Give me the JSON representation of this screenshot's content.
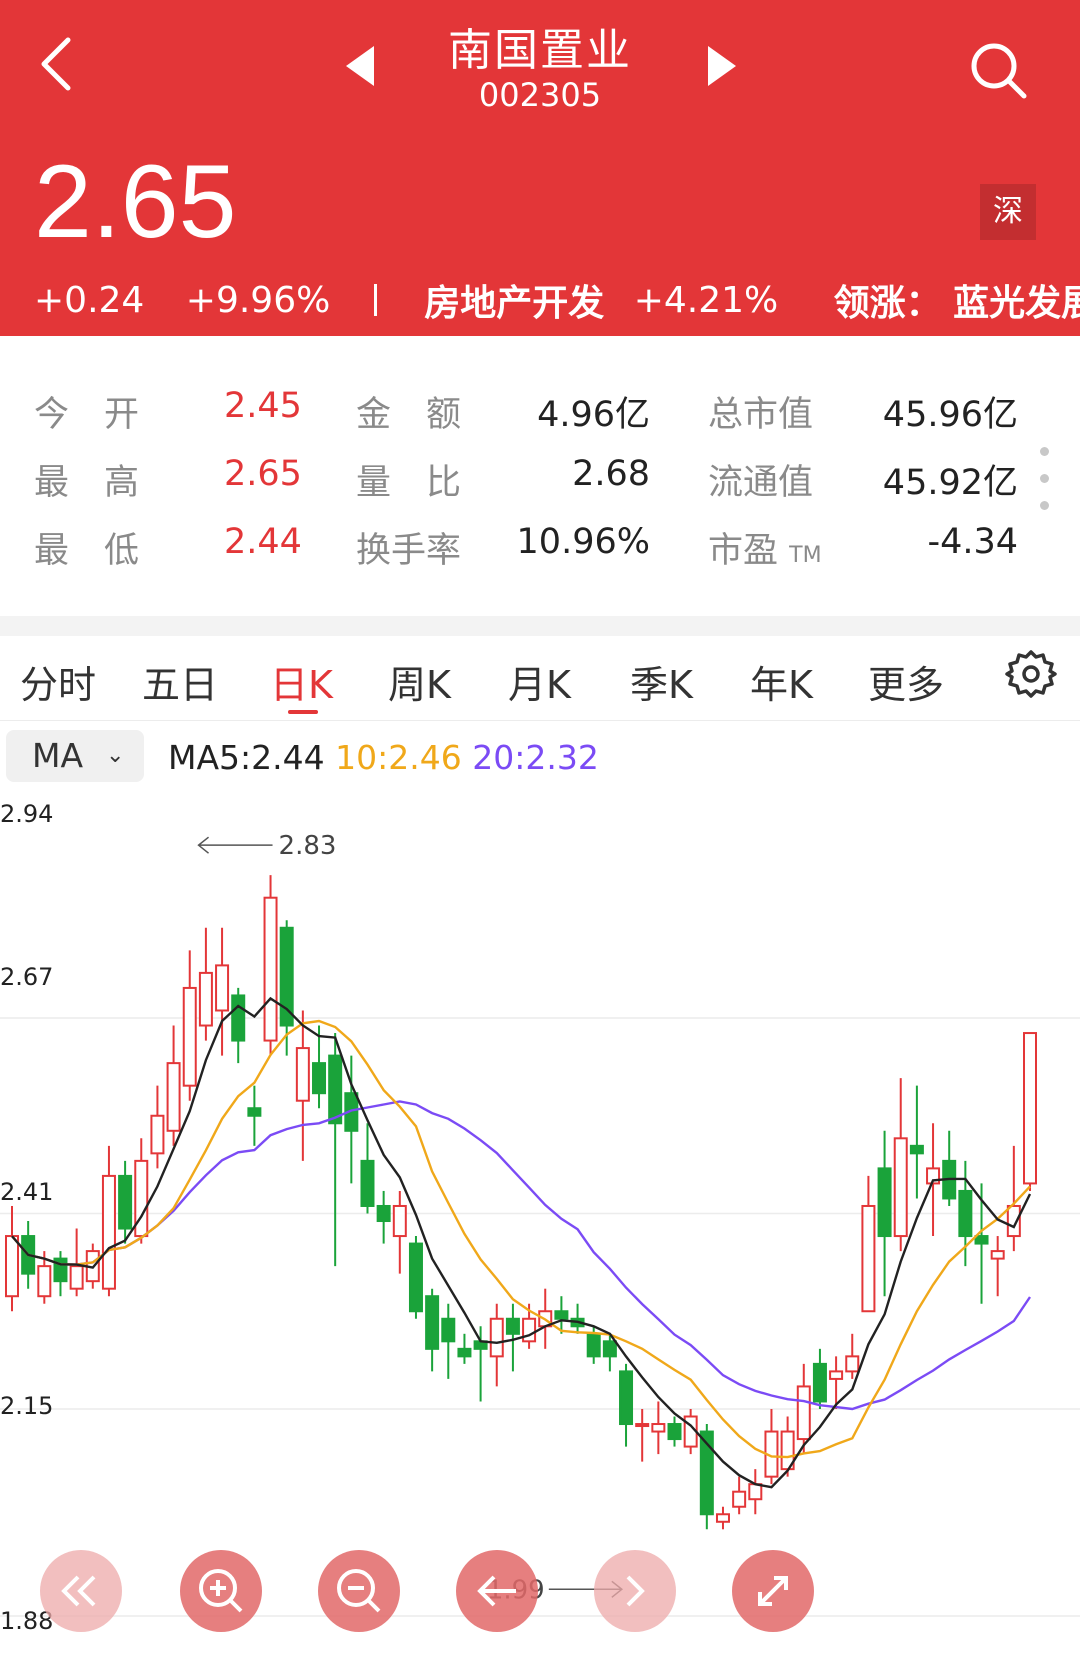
{
  "header": {
    "stock_name": "南国置业",
    "stock_code": "002305",
    "price": "2.65",
    "exchange": "深",
    "change": "+0.24",
    "change_pct": "+9.96%",
    "sector_name": "房地产开发",
    "sector_pct": "+4.21%",
    "leader_label": "领涨：",
    "leader_name": "蓝光发展",
    "bg_color": "#e33638"
  },
  "stats": {
    "open_label": "今　开",
    "open": "2.45",
    "high_label": "最　高",
    "high": "2.65",
    "low_label": "最　低",
    "low": "2.44",
    "amount_label": "金　额",
    "amount": "4.96亿",
    "vol_ratio_label": "量　比",
    "vol_ratio": "2.68",
    "turnover_label": "换手率",
    "turnover": "10.96%",
    "mkt_cap_label": "总市值",
    "mkt_cap": "45.96亿",
    "float_cap_label": "流通值",
    "float_cap": "45.92亿",
    "pe_label": "市盈",
    "pe_suffix": "TM",
    "pe": "-4.34"
  },
  "tabs": [
    "分时",
    "五日",
    "日K",
    "周K",
    "月K",
    "季K",
    "年K",
    "更多"
  ],
  "active_tab": "日K",
  "ma": {
    "selector": "MA",
    "ma5": "MA5:2.44",
    "ma10": "10:2.46",
    "ma20": "20:2.32",
    "colors": {
      "ma5": "#222222",
      "ma10": "#f0a81a",
      "ma20": "#7b4bf5"
    }
  },
  "chart_data": {
    "type": "candlestick",
    "y_ticks": [
      "2.94",
      "2.67",
      "2.41",
      "2.15",
      "1.88"
    ],
    "ylim": [
      1.88,
      2.94
    ],
    "max_marker": "2.83",
    "min_marker": "1.99",
    "up_color": "#e33638",
    "down_color": "#1aa33a",
    "candles": [
      [
        2.3,
        2.38,
        2.42,
        2.28
      ],
      [
        2.38,
        2.33,
        2.4,
        2.31
      ],
      [
        2.3,
        2.34,
        2.36,
        2.29
      ],
      [
        2.35,
        2.32,
        2.36,
        2.3
      ],
      [
        2.31,
        2.34,
        2.39,
        2.3
      ],
      [
        2.32,
        2.36,
        2.37,
        2.31
      ],
      [
        2.31,
        2.46,
        2.5,
        2.3
      ],
      [
        2.46,
        2.39,
        2.48,
        2.37
      ],
      [
        2.38,
        2.48,
        2.51,
        2.37
      ],
      [
        2.49,
        2.54,
        2.58,
        2.47
      ],
      [
        2.52,
        2.61,
        2.66,
        2.5
      ],
      [
        2.58,
        2.71,
        2.76,
        2.56
      ],
      [
        2.66,
        2.73,
        2.79,
        2.64
      ],
      [
        2.68,
        2.74,
        2.79,
        2.62
      ],
      [
        2.7,
        2.64,
        2.71,
        2.61
      ],
      [
        2.55,
        2.54,
        2.58,
        2.5
      ],
      [
        2.64,
        2.83,
        2.86,
        2.62
      ],
      [
        2.79,
        2.66,
        2.8,
        2.62
      ],
      [
        2.56,
        2.63,
        2.68,
        2.48
      ],
      [
        2.61,
        2.57,
        2.66,
        2.55
      ],
      [
        2.62,
        2.53,
        2.65,
        2.34
      ],
      [
        2.57,
        2.52,
        2.62,
        2.45
      ],
      [
        2.48,
        2.42,
        2.53,
        2.41
      ],
      [
        2.42,
        2.4,
        2.44,
        2.37
      ],
      [
        2.38,
        2.42,
        2.44,
        2.33
      ],
      [
        2.37,
        2.28,
        2.38,
        2.27
      ],
      [
        2.3,
        2.23,
        2.31,
        2.2
      ],
      [
        2.27,
        2.24,
        2.29,
        2.19
      ],
      [
        2.23,
        2.22,
        2.25,
        2.21
      ],
      [
        2.24,
        2.23,
        2.26,
        2.16
      ],
      [
        2.22,
        2.27,
        2.29,
        2.18
      ],
      [
        2.27,
        2.25,
        2.29,
        2.2
      ],
      [
        2.24,
        2.27,
        2.29,
        2.23
      ],
      [
        2.26,
        2.28,
        2.31,
        2.23
      ],
      [
        2.28,
        2.27,
        2.3,
        2.25
      ],
      [
        2.27,
        2.26,
        2.29,
        2.25
      ],
      [
        2.25,
        2.22,
        2.26,
        2.21
      ],
      [
        2.24,
        2.22,
        2.25,
        2.2
      ],
      [
        2.2,
        2.13,
        2.21,
        2.1
      ],
      [
        2.13,
        2.13,
        2.15,
        2.08
      ],
      [
        2.12,
        2.13,
        2.16,
        2.09
      ],
      [
        2.13,
        2.11,
        2.14,
        2.1
      ],
      [
        2.1,
        2.14,
        2.15,
        2.09
      ],
      [
        2.12,
        2.01,
        2.13,
        1.99
      ],
      [
        2.0,
        2.01,
        2.02,
        1.99
      ],
      [
        2.02,
        2.04,
        2.06,
        2.01
      ],
      [
        2.03,
        2.05,
        2.07,
        2.01
      ],
      [
        2.06,
        2.12,
        2.15,
        2.05
      ],
      [
        2.07,
        2.12,
        2.14,
        2.06
      ],
      [
        2.11,
        2.18,
        2.21,
        2.09
      ],
      [
        2.21,
        2.16,
        2.23,
        2.15
      ],
      [
        2.19,
        2.2,
        2.22,
        2.15
      ],
      [
        2.2,
        2.22,
        2.25,
        2.19
      ],
      [
        2.28,
        2.42,
        2.46,
        2.28
      ],
      [
        2.47,
        2.38,
        2.52,
        2.3
      ],
      [
        2.38,
        2.51,
        2.59,
        2.36
      ],
      [
        2.5,
        2.49,
        2.58,
        2.43
      ],
      [
        2.45,
        2.47,
        2.53,
        2.38
      ],
      [
        2.48,
        2.43,
        2.52,
        2.42
      ],
      [
        2.44,
        2.38,
        2.48,
        2.34
      ],
      [
        2.38,
        2.37,
        2.45,
        2.29
      ],
      [
        2.35,
        2.36,
        2.38,
        2.3
      ],
      [
        2.38,
        2.42,
        2.5,
        2.36
      ],
      [
        2.45,
        2.65,
        2.65,
        2.44
      ]
    ]
  }
}
